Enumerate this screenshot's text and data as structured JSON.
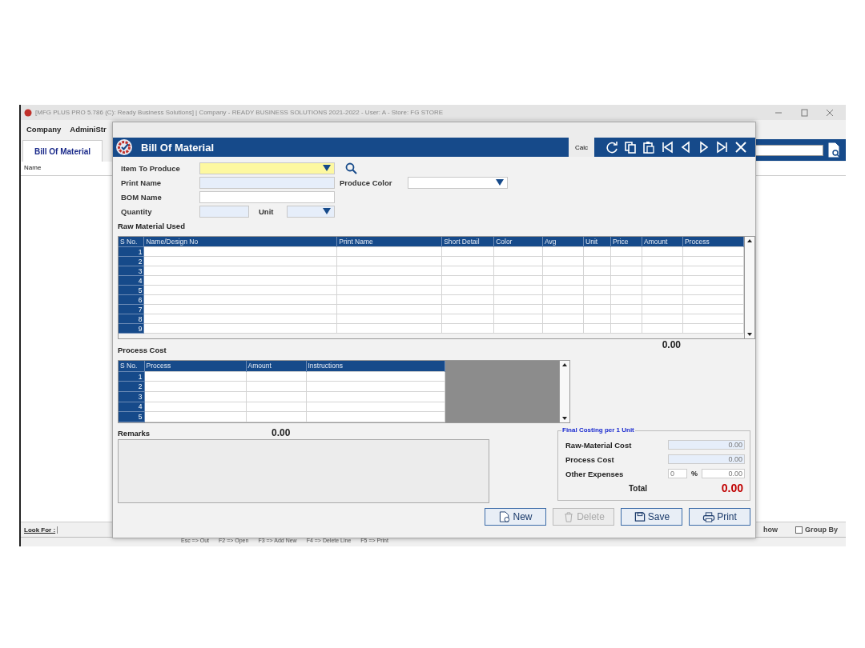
{
  "app_window": {
    "title": "[MFG PLUS PRO 5.786 (C): Ready Business Solutions] | Company - READY BUSINESS SOLUTIONS 2021-2022 - User: A - Store: FG STORE",
    "menu": [
      {
        "label": "Company"
      },
      {
        "label": "AdminiStr"
      }
    ],
    "tabs": [
      {
        "label": "Bill Of Material",
        "selected": true
      }
    ],
    "list_columns": [
      "Name"
    ],
    "look_for": "Look For :",
    "show_label": "how",
    "group_by": {
      "label": "Group By",
      "checked": false
    },
    "status_bar": [
      "Esc => Out",
      "F2 => Open",
      "F3 => Add New",
      "F4 => Delete Line",
      "F5 => Print"
    ]
  },
  "dialog": {
    "title": "Bill Of Material",
    "calc_button": "Calc",
    "form_rows": [
      [
        {
          "label": "Item To Produce",
          "kind": "item-combo",
          "highlighted": true
        }
      ],
      [
        {
          "label": "Print Name",
          "kind": "text",
          "highlighted": false,
          "shaded": true
        },
        {
          "label": "Produce Color",
          "kind": "color-combo",
          "highlighted": false,
          "shaded": false
        }
      ],
      [
        {
          "label": "BOM Name",
          "kind": "text",
          "highlighted": false,
          "shaded": false
        }
      ],
      [
        {
          "label": "Quantity",
          "kind": "number",
          "highlighted": false,
          "shaded": true
        },
        {
          "label": "Unit",
          "kind": "small-combo",
          "highlighted": false,
          "shaded": true
        }
      ]
    ],
    "raw_material": {
      "title": "Raw Material Used",
      "columns": [
        "S No.",
        "Name/Design No",
        "Print Name",
        "Short Detail",
        "Color",
        "Avg",
        "Unit",
        "Price",
        "Amount",
        "Process"
      ],
      "rows": [
        "1",
        "2",
        "3",
        "4",
        "5",
        "6",
        "7",
        "8",
        "9"
      ],
      "total": "0.00"
    },
    "process_cost": {
      "title": "Process Cost",
      "columns": [
        "S No.",
        "Process",
        "Amount",
        "Instructions"
      ],
      "rows": [
        "1",
        "2",
        "3",
        "4",
        "5"
      ],
      "total": "0.00"
    },
    "remarks": {
      "label": "Remarks"
    },
    "final_costing": {
      "title": "Final Costing per 1 Unit",
      "rows": [
        {
          "label": "Raw-Material Cost",
          "value": "0.00"
        },
        {
          "label": "Process Cost",
          "value": "0.00"
        }
      ],
      "other_expenses": {
        "label": "Other Expenses",
        "percent": "0",
        "percent_sign": "%",
        "value": "0.00"
      },
      "total": {
        "label": "Total",
        "value": "0.00"
      }
    },
    "buttons": [
      {
        "label": "New",
        "kind": "new",
        "disabled": false
      },
      {
        "label": "Delete",
        "kind": "delete",
        "disabled": true
      },
      {
        "label": "Save",
        "kind": "save",
        "disabled": false
      },
      {
        "label": "Print",
        "kind": "print",
        "disabled": false
      }
    ]
  }
}
